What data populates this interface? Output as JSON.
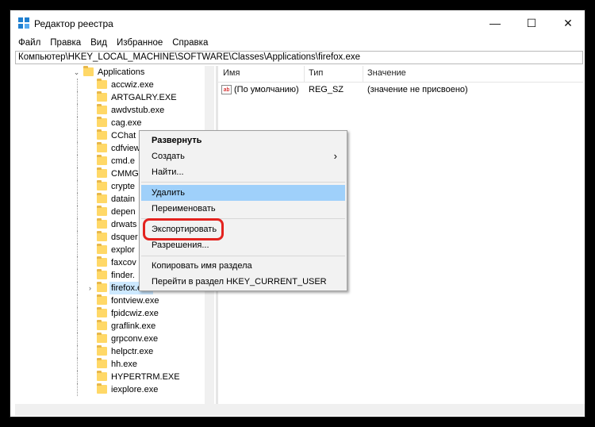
{
  "window": {
    "title": "Редактор реестра",
    "icon": "registry-icon"
  },
  "controls": {
    "minimize": "—",
    "maximize": "☐",
    "close": "✕"
  },
  "menu": [
    "Файл",
    "Правка",
    "Вид",
    "Избранное",
    "Справка"
  ],
  "address": "Компьютер\\HKEY_LOCAL_MACHINE\\SOFTWARE\\Classes\\Applications\\firefox.exe",
  "tree": {
    "parent": "Applications",
    "items": [
      "accwiz.exe",
      "ARTGALRY.EXE",
      "awdvstub.exe",
      "cag.exe",
      "CChat",
      "cdfview",
      "cmd.e",
      "CMMG",
      "crypte",
      "datain",
      "depen",
      "drwats",
      "dsquer",
      "explor",
      "faxcov",
      "finder.",
      "firefox.exe",
      "fontview.exe",
      "fpidcwiz.exe",
      "graflink.exe",
      "grpconv.exe",
      "helpctr.exe",
      "hh.exe",
      "HYPERTRM.EXE",
      "iexplore.exe"
    ],
    "selected_index": 16
  },
  "list": {
    "columns": [
      "Имя",
      "Тип",
      "Значение"
    ],
    "rows": [
      {
        "name": "(По умолчанию)",
        "type": "REG_SZ",
        "value": "(значение не присвоено)"
      }
    ]
  },
  "context_menu": {
    "expand": "Развернуть",
    "create": "Создать",
    "find": "Найти...",
    "delete": "Удалить",
    "rename": "Переименовать",
    "export": "Экспортировать",
    "permissions": "Разрешения...",
    "copy_key_name": "Копировать имя раздела",
    "goto_hkcu": "Перейти в раздел HKEY_CURRENT_USER",
    "submenu_arrow": "›"
  },
  "colors": {
    "highlight": "#9fd0fa",
    "annotation_red": "#e3231f",
    "folder": "#ffd867"
  }
}
